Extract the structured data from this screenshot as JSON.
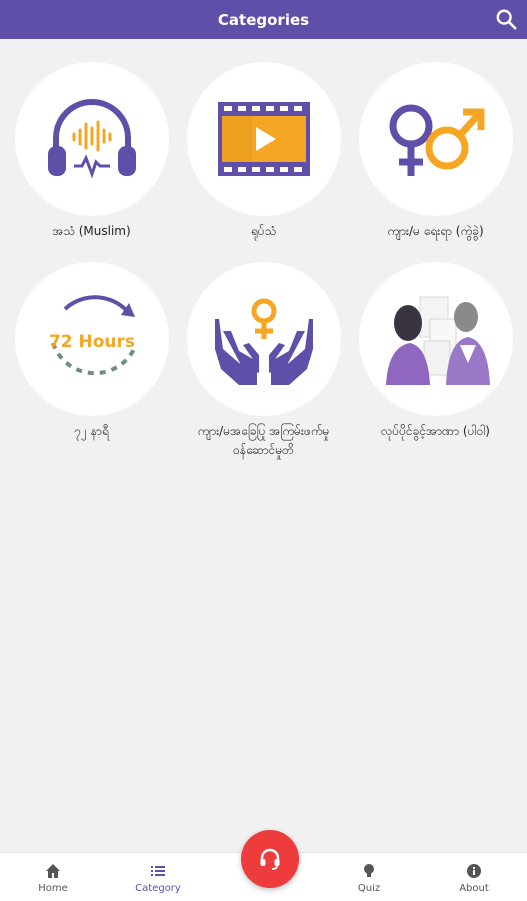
{
  "header": {
    "title": "Categories"
  },
  "icons": {
    "search": "search-icon",
    "fab": "headset-icon"
  },
  "categories": [
    {
      "label": "အသံ (Muslim)",
      "icon": "headphones-icon"
    },
    {
      "label": "ရုပ်သံ",
      "icon": "video-film-icon"
    },
    {
      "label": "ကျား/မ ရေးရာ (ကွဲခွဲ)",
      "icon": "gender-symbols-icon"
    },
    {
      "label": "၇၂ နာရီ",
      "icon": "72-hours-icon"
    },
    {
      "label": "ကျား/မအခြေပြု အကြမ်းဖက်မှု ဝန်ဆောင်မှုတိ",
      "icon": "protective-hands-icon"
    },
    {
      "label": "လုပ်ပိုင်ခွင့်အာဏာ (ပါဝါ)",
      "icon": "people-discussion-icon"
    }
  ],
  "hours_badge": "72 Hours",
  "nav": {
    "home": "Home",
    "category": "Category",
    "quiz": "Quiz",
    "about": "About"
  },
  "colors": {
    "primary": "#5f4fa8",
    "accent": "#f5a623",
    "fab": "#ee3b3b"
  }
}
